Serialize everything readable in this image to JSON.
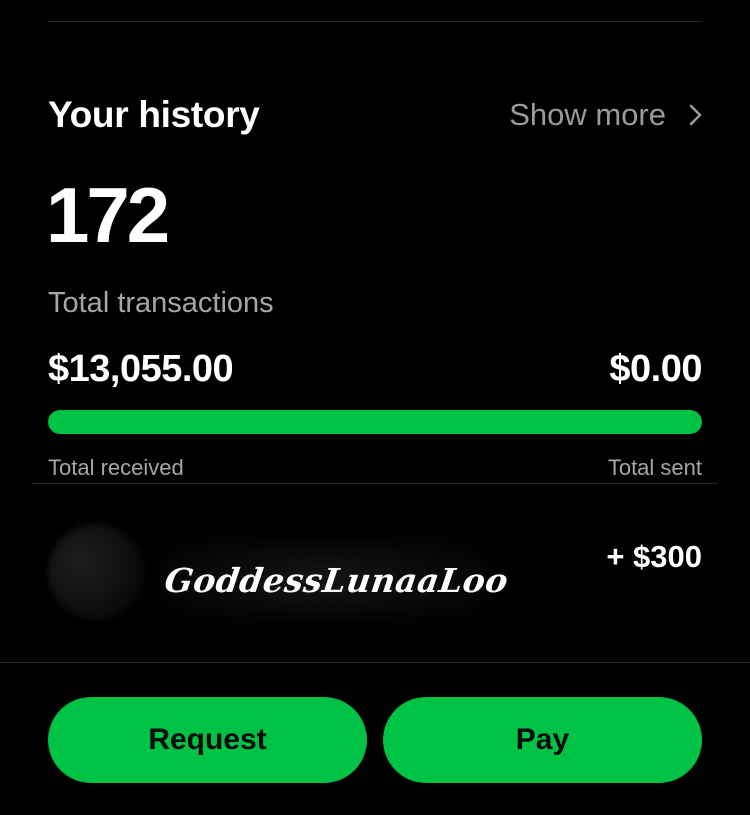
{
  "colors": {
    "background": "#000000",
    "accent_green": "#00c244",
    "muted_text": "#a6a6a6",
    "divider": "#2a2a2a"
  },
  "history": {
    "title": "Your history",
    "show_more_label": "Show more",
    "show_more_icon": "chevron-right-icon",
    "transaction_count": "172",
    "transaction_count_label": "Total transactions"
  },
  "totals": {
    "received_amount": "$13,055.00",
    "sent_amount": "$0.00",
    "received_label": "Total received",
    "sent_label": "Total sent",
    "received_share_percent": 100
  },
  "transaction": {
    "name_signature": "GoddessLunaaLoo",
    "amount": "+ $300",
    "avatar_icon": "avatar-icon"
  },
  "actions": {
    "request_label": "Request",
    "pay_label": "Pay"
  }
}
